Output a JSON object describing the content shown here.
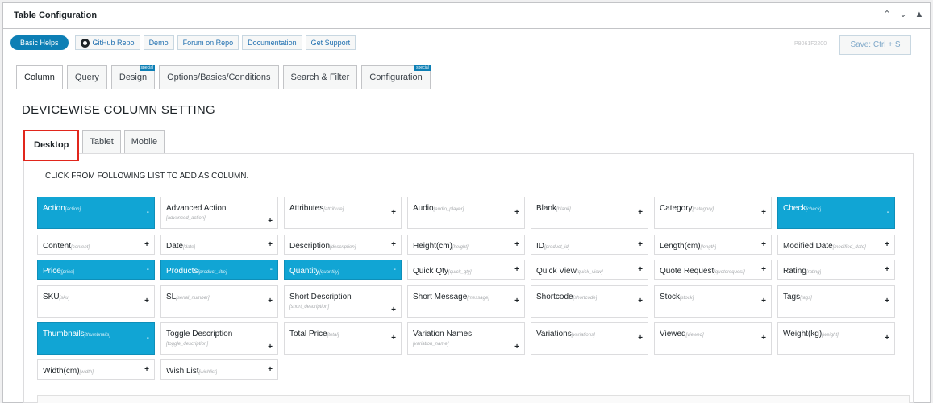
{
  "panel": {
    "title": "Table Configuration"
  },
  "toolbar": {
    "basic_helps": "Basic Helps",
    "links": [
      "GitHub Repo",
      "Demo",
      "Forum on Repo",
      "Documentation",
      "Get Support"
    ],
    "id_label": "P8061F2200",
    "save_label": "Save: Ctrl + S"
  },
  "tabs": [
    {
      "label": "Column",
      "active": true,
      "badge": ""
    },
    {
      "label": "Query",
      "active": false,
      "badge": ""
    },
    {
      "label": "Design",
      "active": false,
      "badge": "special"
    },
    {
      "label": "Options/Basics/Conditions",
      "active": false,
      "badge": ""
    },
    {
      "label": "Search & Filter",
      "active": false,
      "badge": ""
    },
    {
      "label": "Configuration",
      "active": false,
      "badge": "special"
    }
  ],
  "section_title": "DEVICEWISE COLUMN SETTING",
  "device_tabs": [
    "Desktop",
    "Tablet",
    "Mobile"
  ],
  "instruction": "CLICK FROM FOLLOWING LIST TO ADD AS COLUMN.",
  "columns": [
    [
      {
        "name": "Action",
        "key": "action",
        "active": true,
        "tall": true
      },
      {
        "name": "Advanced Action",
        "key": "advanced_action",
        "active": false,
        "tall": true,
        "keyBelow": true
      },
      {
        "name": "Attributes",
        "key": "attribute",
        "active": false,
        "tall": true
      },
      {
        "name": "Audio",
        "key": "audio_player",
        "active": false,
        "tall": true
      },
      {
        "name": "Blank",
        "key": "blank",
        "active": false,
        "tall": true
      },
      {
        "name": "Category",
        "key": "category",
        "active": false,
        "tall": true
      },
      {
        "name": "Check",
        "key": "check",
        "active": true,
        "tall": true
      }
    ],
    [
      {
        "name": "Content",
        "key": "content",
        "active": false
      },
      {
        "name": "Date",
        "key": "date",
        "active": false
      },
      {
        "name": "Description",
        "key": "description",
        "active": false
      },
      {
        "name": "Height(cm)",
        "key": "height",
        "active": false
      },
      {
        "name": "ID",
        "key": "product_id",
        "active": false
      },
      {
        "name": "Length(cm)",
        "key": "length",
        "active": false
      },
      {
        "name": "Modified Date",
        "key": "modified_date",
        "active": false
      }
    ],
    [
      {
        "name": "Price",
        "key": "price",
        "active": true
      },
      {
        "name": "Products",
        "key": "product_title",
        "active": true
      },
      {
        "name": "Quantity",
        "key": "quantity",
        "active": true
      },
      {
        "name": "Quick Qty",
        "key": "quick_qty",
        "active": false
      },
      {
        "name": "Quick View",
        "key": "quick_view",
        "active": false
      },
      {
        "name": "Quote Request",
        "key": "quoterequest",
        "active": false
      },
      {
        "name": "Rating",
        "key": "rating",
        "active": false
      }
    ],
    [
      {
        "name": "SKU",
        "key": "sku",
        "active": false,
        "tall": true
      },
      {
        "name": "SL",
        "key": "serial_number",
        "active": false,
        "tall": true
      },
      {
        "name": "Short Description",
        "key": "short_description",
        "active": false,
        "tall": true,
        "keyBelow": true
      },
      {
        "name": "Short Message",
        "key": "message",
        "active": false,
        "tall": true
      },
      {
        "name": "Shortcode",
        "key": "shortcode",
        "active": false,
        "tall": true
      },
      {
        "name": "Stock",
        "key": "stock",
        "active": false,
        "tall": true
      },
      {
        "name": "Tags",
        "key": "tags",
        "active": false,
        "tall": true
      }
    ],
    [
      {
        "name": "Thumbnails",
        "key": "thumbnails",
        "active": true,
        "tall": true
      },
      {
        "name": "Toggle Description",
        "key": "toggle_description",
        "active": false,
        "tall": true,
        "keyBelow": true
      },
      {
        "name": "Total Price",
        "key": "total",
        "active": false,
        "tall": true
      },
      {
        "name": "Variation Names",
        "key": "variation_name",
        "active": false,
        "tall": true,
        "keyBelow": true
      },
      {
        "name": "Variations",
        "key": "variations",
        "active": false,
        "tall": true
      },
      {
        "name": "Viewed",
        "key": "viewed",
        "active": false,
        "tall": true
      },
      {
        "name": "Weight(kg)",
        "key": "weight",
        "active": false,
        "tall": true
      }
    ],
    [
      {
        "name": "Width(cm)",
        "key": "width",
        "active": false
      },
      {
        "name": "Wish List",
        "key": "wishlist",
        "active": false
      }
    ]
  ],
  "colors": {
    "accent": "#11a5d4",
    "primary": "#0d7fb5",
    "highlight": "#e1261c"
  }
}
